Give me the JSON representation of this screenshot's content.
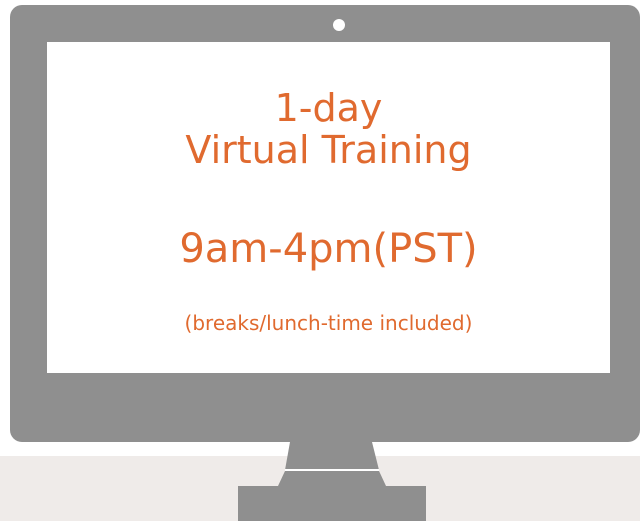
{
  "screen": {
    "line1": "1-day",
    "line2": "Virtual Training",
    "line3": "9am-4pm(PST)",
    "line4": "(breaks/lunch-time included)"
  },
  "colors": {
    "monitor": "#8f8f8f",
    "text_accent": "#e06a2f",
    "floor": "#efebe9",
    "screen": "#ffffff"
  },
  "icons": {
    "camera": "camera-dot-icon",
    "stand": "monitor-stand-icon"
  }
}
